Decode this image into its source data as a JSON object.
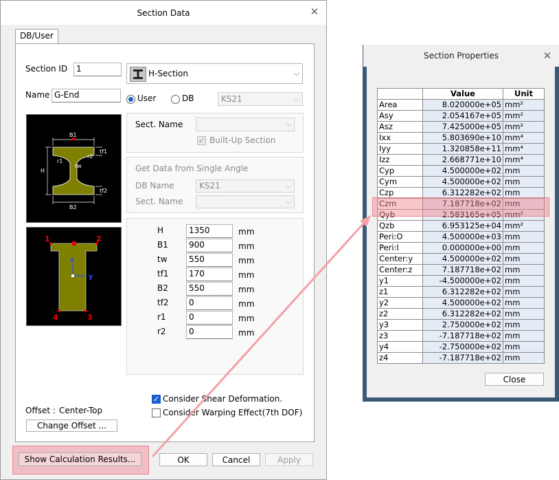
{
  "section_dialog": {
    "title": "Section Data",
    "tab": "DB/User",
    "section_id_label": "Section ID",
    "section_id_value": "1",
    "shape_type": "H-Section",
    "name_label": "Name",
    "name_value": "G-End",
    "radio_user": "User",
    "radio_db": "DB",
    "db_value": "KS21",
    "sect_name_label": "Sect. Name",
    "built_up_label": "Built-Up Section",
    "single_angle_title": "Get Data from Single Angle",
    "db_name_label": "DB Name",
    "db_name_value": "KS21",
    "sect_name_label2": "Sect. Name",
    "diagram_labels": {
      "b1": "B1",
      "b2": "B2",
      "h": "H",
      "tw": "tw",
      "tf1": "tf1",
      "tf2": "tf2",
      "r1": "r1",
      "r2": "r2"
    },
    "corner_labels": {
      "c1": "1",
      "c2": "2",
      "c3": "3",
      "c4": "4",
      "z": "z",
      "y": "y"
    },
    "dims": [
      {
        "label": "H",
        "value": "1350",
        "unit": "mm"
      },
      {
        "label": "B1",
        "value": "900",
        "unit": "mm"
      },
      {
        "label": "tw",
        "value": "550",
        "unit": "mm"
      },
      {
        "label": "tf1",
        "value": "170",
        "unit": "mm"
      },
      {
        "label": "B2",
        "value": "550",
        "unit": "mm"
      },
      {
        "label": "tf2",
        "value": "0",
        "unit": "mm"
      },
      {
        "label": "r1",
        "value": "0",
        "unit": "mm"
      },
      {
        "label": "r2",
        "value": "0",
        "unit": "mm"
      }
    ],
    "shear_label": "Consider Shear Deformation.",
    "warping_label": "Consider Warping Effect(7th DOF)",
    "offset_label": "Offset :",
    "offset_value": "Center-Top",
    "change_offset": "Change Offset ...",
    "show_calc": "Show Calculation Results...",
    "ok": "OK",
    "cancel": "Cancel",
    "apply": "Apply"
  },
  "props_dialog": {
    "title": "Section Properties",
    "col_value": "Value",
    "col_unit": "Unit",
    "close": "Close",
    "rows": [
      {
        "name": "Area",
        "value": "8.020000e+05",
        "unit": "mm²"
      },
      {
        "name": "Asy",
        "value": "2.054167e+05",
        "unit": "mm²"
      },
      {
        "name": "Asz",
        "value": "7.425000e+05",
        "unit": "mm²"
      },
      {
        "name": "Ixx",
        "value": "5.803690e+10",
        "unit": "mm⁴"
      },
      {
        "name": "Iyy",
        "value": "1.320858e+11",
        "unit": "mm⁴"
      },
      {
        "name": "Izz",
        "value": "2.668771e+10",
        "unit": "mm⁴"
      },
      {
        "name": "Cyp",
        "value": "4.500000e+02",
        "unit": "mm"
      },
      {
        "name": "Cym",
        "value": "4.500000e+02",
        "unit": "mm"
      },
      {
        "name": "Czp",
        "value": "6.312282e+02",
        "unit": "mm"
      },
      {
        "name": "Czm",
        "value": "7.187718e+02",
        "unit": "mm"
      },
      {
        "name": "Qyb",
        "value": "2.583165e+05",
        "unit": "mm²"
      },
      {
        "name": "Qzb",
        "value": "6.953125e+04",
        "unit": "mm²"
      },
      {
        "name": "Peri:O",
        "value": "4.500000e+03",
        "unit": "mm"
      },
      {
        "name": "Peri:I",
        "value": "0.000000e+00",
        "unit": "mm"
      },
      {
        "name": "Center:y",
        "value": "4.500000e+02",
        "unit": "mm"
      },
      {
        "name": "Center:z",
        "value": "7.187718e+02",
        "unit": "mm"
      },
      {
        "name": "y1",
        "value": "-4.500000e+02",
        "unit": "mm"
      },
      {
        "name": "z1",
        "value": "6.312282e+02",
        "unit": "mm"
      },
      {
        "name": "y2",
        "value": "4.500000e+02",
        "unit": "mm"
      },
      {
        "name": "z2",
        "value": "6.312282e+02",
        "unit": "mm"
      },
      {
        "name": "y3",
        "value": "2.750000e+02",
        "unit": "mm"
      },
      {
        "name": "z3",
        "value": "-7.187718e+02",
        "unit": "mm"
      },
      {
        "name": "y4",
        "value": "-2.750000e+02",
        "unit": "mm"
      },
      {
        "name": "z4",
        "value": "-7.187718e+02",
        "unit": "mm"
      }
    ]
  },
  "colors": {
    "highlight": "#f08a94",
    "arrow": "#f4a0a8",
    "section_fill": "#808000",
    "accent": "#1b5fcc"
  }
}
